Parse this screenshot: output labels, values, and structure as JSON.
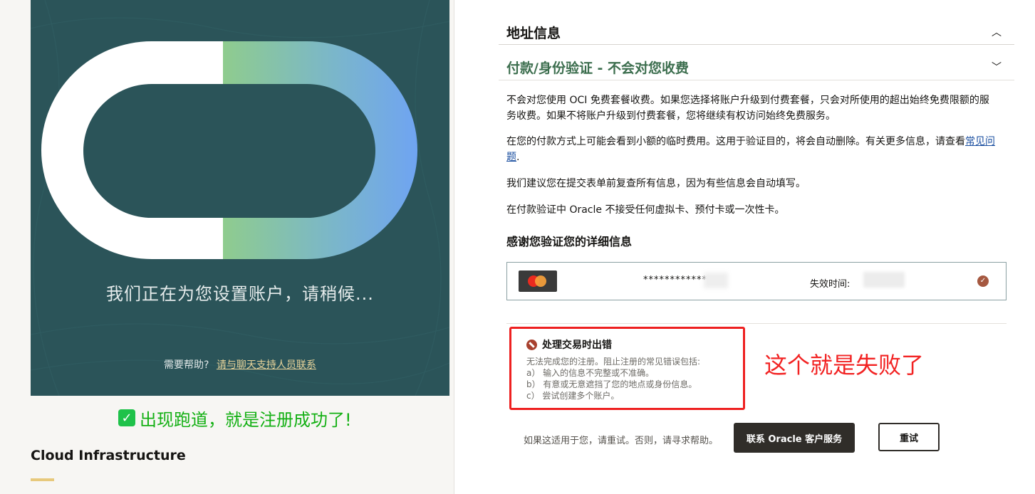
{
  "left": {
    "hero_message": "我们正在为您设置账户，请稍候...",
    "help_prefix": "需要帮助?",
    "help_link": "请与聊天支持人员联系",
    "success_note": "出现跑道，就是注册成功了!",
    "product_title": "Cloud Infrastructure"
  },
  "right": {
    "address_section": "地址信息",
    "payment_section": "付款/身份验证 - 不会对您收费",
    "para1": "不会对您使用 OCI 免费套餐收费。如果您选择将账户升级到付费套餐，只会对所使用的超出始终免费限额的服务收费。如果不将账户升级到付费套餐，您将继续有权访问始终免费服务。",
    "para2_prefix": "在您的付款方式上可能会看到小额的临时费用。这用于验证目的，将会自动删除。有关更多信息，请查看",
    "para2_link": "常见问题",
    "para2_suffix": ".",
    "para3": "我们建议您在提交表单前复查所有信息，因为有些信息会自动填写。",
    "para4": "在付款验证中 Oracle 不接受任何虚拟卡、预付卡或一次性卡。",
    "verify_title": "感谢您验证您的详细信息",
    "card": {
      "number_masked": "************",
      "expiry_label": "失效时间:",
      "verified_glyph": "✓"
    },
    "error": {
      "title": "处理交易时出错",
      "lines": [
        "无法完成您的注册。阻止注册的常见错误包括:",
        "a） 输入的信息不完整或不准确。",
        "b） 有意或无意遮挡了您的地点或身份信息。",
        "c） 尝试创建多个账户。"
      ]
    },
    "annotation": "这个就是失败了",
    "help_text": "如果这适用于您，请重试。否则，请寻求帮助。",
    "contact_button": "联系 Oracle 客户服务",
    "retry_button": "重试"
  },
  "colors": {
    "hero_bg": "#2b5459",
    "accent_green": "#3c6e4e",
    "error_red": "#ee2020",
    "success_green": "#14b014"
  },
  "icons": {
    "collapse": "chevron-up-icon",
    "expand": "chevron-down-icon",
    "error": "ban-icon",
    "check": "check-icon"
  }
}
